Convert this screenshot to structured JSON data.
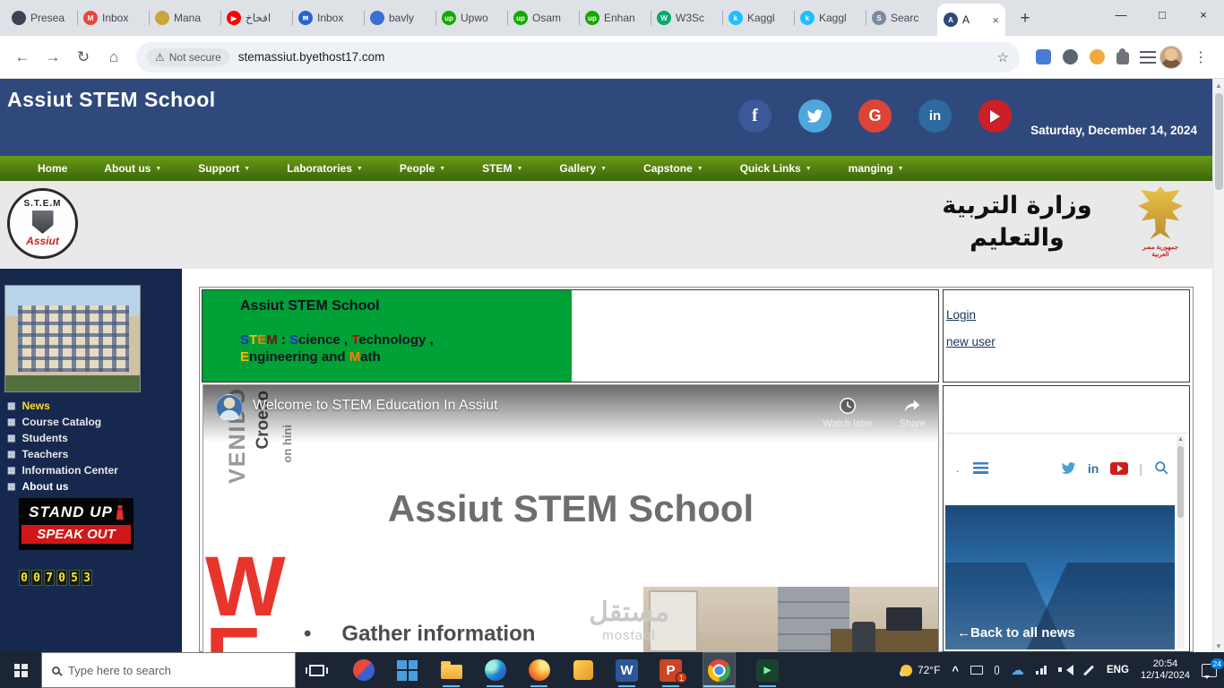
{
  "colors": {
    "header_bg": "#30497c",
    "nav_green_top": "#6a9a16",
    "nav_green_bottom": "#3a660a",
    "sidebar_bg": "#16284e",
    "banner_green": "#00a136",
    "taskbar_bg": "#1c2534",
    "facebook": "#3b5998",
    "twitter": "#4fa6dc",
    "google": "#db4437",
    "linkedin": "#2d6a9f",
    "youtube": "#cb2027"
  },
  "browser": {
    "tab_close_icon": "×",
    "new_tab_button": "+",
    "window_controls": {
      "minimize": "—",
      "maximize": "□",
      "close": "×"
    },
    "scrollbar": {
      "up": "▲",
      "down": "▼"
    },
    "tabs": [
      {
        "label": "Presea",
        "fav_color": "#3a4254",
        "fav_glyph": ""
      },
      {
        "label": "Inbox",
        "fav_color": "#e8453c",
        "fav_glyph": "M"
      },
      {
        "label": "Mana",
        "fav_color": "#caa53d",
        "fav_glyph": ""
      },
      {
        "label": "افخاخ",
        "fav_color": "#ff0000",
        "fav_glyph": "▶"
      },
      {
        "label": "Inbox",
        "fav_color": "#2864c8",
        "fav_glyph": "✉"
      },
      {
        "label": "bavly",
        "fav_color": "#3b6fd4",
        "fav_glyph": ""
      },
      {
        "label": "Upwo",
        "fav_color": "#14a800",
        "fav_glyph": "up"
      },
      {
        "label": "Osam",
        "fav_color": "#14a800",
        "fav_glyph": "up"
      },
      {
        "label": "Enhan",
        "fav_color": "#14a800",
        "fav_glyph": "up"
      },
      {
        "label": "W3Sc",
        "fav_color": "#04aa6d",
        "fav_glyph": "W"
      },
      {
        "label": "Kaggl",
        "fav_color": "#20beff",
        "fav_glyph": "k"
      },
      {
        "label": "Kaggl",
        "fav_color": "#20beff",
        "fav_glyph": "k"
      },
      {
        "label": "Searc",
        "fav_color": "#7a8aa0",
        "fav_glyph": "S"
      },
      {
        "label": "A",
        "fav_color": "#30497c",
        "fav_glyph": "A",
        "active": true
      }
    ],
    "toolbar": {
      "back_icon": "←",
      "forward_icon": "→",
      "reload_icon": "↻",
      "home_icon": "⌂",
      "warning_icon": "⚠",
      "security_label": "Not secure",
      "url": "stemassiut.byethost17.com",
      "star_icon": "☆",
      "menu_icon": "⋮",
      "extensions": [
        {
          "name": "extension-blue-square",
          "color": "#4a7bd4",
          "shape": "square"
        },
        {
          "name": "extension-dark-circle",
          "color": "#5a6472",
          "shape": "circle"
        },
        {
          "name": "extension-orange-circle",
          "color": "#f2a93b",
          "shape": "circle"
        },
        {
          "name": "extension-puzzle",
          "color": "#707379",
          "shape": "puzzle"
        }
      ]
    }
  },
  "site": {
    "header": {
      "title": "Assiut STEM School",
      "date": "Saturday, December 14, 2024",
      "social_glyphs": {
        "facebook": "f",
        "google": "G",
        "linkedin": "in"
      }
    },
    "nav_caret": "▼",
    "nav": [
      {
        "label": "Home",
        "caret": false
      },
      {
        "label": "About us",
        "caret": true
      },
      {
        "label": "Support",
        "caret": true
      },
      {
        "label": "Laboratories",
        "caret": true
      },
      {
        "label": "People",
        "caret": true
      },
      {
        "label": "STEM",
        "caret": true
      },
      {
        "label": "Gallery",
        "caret": true
      },
      {
        "label": "Capstone",
        "caret": true
      },
      {
        "label": "Quick Links",
        "caret": true
      },
      {
        "label": "manging",
        "caret": true
      }
    ],
    "logo": {
      "arc_text": "S.T.E.M",
      "bottom_text": "Assiut"
    },
    "ministry_calligraphy": "وزارة التربية والتعليم",
    "emblem_caption": "جمهورية مصر العربية",
    "sidebar": {
      "item_icon": "▦",
      "items": [
        {
          "label": "News",
          "color": "#ffd83d"
        },
        {
          "label": "Course Catalog",
          "color": "#e8e8e8"
        },
        {
          "label": "Students",
          "color": "#e8e8e8"
        },
        {
          "label": "Teachers",
          "color": "#e8e8e8"
        },
        {
          "label": "Information Center",
          "color": "#e8e8e8"
        },
        {
          "label": "About us",
          "color": "#ffffff"
        }
      ],
      "poster": {
        "line1": "STAND UP",
        "line2": "SPEAK OUT"
      },
      "counter": "007053"
    },
    "banner": {
      "title": "Assiut STEM School",
      "stem_line1": [
        [
          "S",
          "#2a2ad4"
        ],
        [
          "T",
          "#e8c413"
        ],
        [
          "E",
          "#ff7a00"
        ],
        [
          "M",
          "#7a1010"
        ],
        [
          " : ",
          "#15151f"
        ],
        [
          "S",
          "#2a2ad4"
        ],
        [
          "cience , ",
          "#15151f"
        ],
        [
          "T",
          "#d40000"
        ],
        [
          "echnology ,",
          "#15151f"
        ]
      ],
      "stem_line2": [
        [
          "E",
          "#ffb400"
        ],
        [
          "ngineering and ",
          "#15151f"
        ],
        [
          "M",
          "#ff7a00"
        ],
        [
          "ath",
          "#15151f"
        ]
      ]
    },
    "login_panel": {
      "login": "Login",
      "new_user": "new user"
    },
    "video": {
      "title": "Welcome to STEM Education In Assiut",
      "watch_later": "Watch later",
      "share": "Share",
      "slide_heading": "Assiut STEM School",
      "bullet_marker": "•",
      "bullet_text": "Gather information",
      "vertical_words": [
        "Croeso",
        "VENIDO",
        "on hini"
      ],
      "big_letters": [
        "W",
        "E"
      ]
    },
    "watermark": {
      "arabic": "مستقل",
      "latin": "mostaql"
    },
    "news_widget": {
      "dot": ".",
      "divider": "|",
      "back_arrow": "←",
      "back_label": "Back to all news"
    }
  },
  "taskbar": {
    "search_placeholder": "Type here to search",
    "weather": "72°F",
    "tray_chevron": "^",
    "language": "ENG",
    "clock_time": "20:54",
    "clock_date": "12/14/2024",
    "notification_count": "24",
    "apps": [
      {
        "icon": "redblue",
        "open": false
      },
      {
        "icon": "tiles",
        "open": false
      },
      {
        "icon": "folder",
        "open": true
      },
      {
        "icon": "edge",
        "open": true
      },
      {
        "icon": "firefox",
        "open": true
      },
      {
        "icon": "yellow",
        "open": false
      },
      {
        "icon": "word",
        "letter": "W",
        "open": true
      },
      {
        "icon": "ppt",
        "letter": "P",
        "badge": "1",
        "open": true
      },
      {
        "icon": "chrome",
        "open": true,
        "active": true
      },
      {
        "icon": "green",
        "letter": "▶",
        "open": true
      }
    ]
  }
}
